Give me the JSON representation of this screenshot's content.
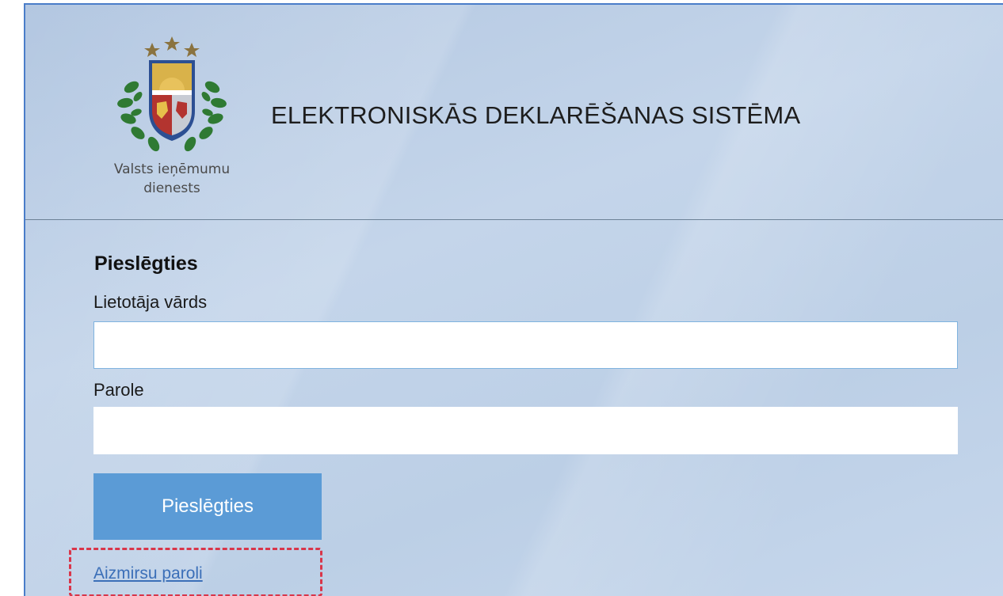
{
  "header": {
    "agency_line1": "Valsts ieņēmumu",
    "agency_line2": "dienests",
    "system_title": "ELEKTRONISKĀS DEKLARĒŠANAS SISTĒMA",
    "logo_icon": "latvia-coat-of-arms-icon"
  },
  "login": {
    "heading": "Pieslēgties",
    "username_label": "Lietotāja vārds",
    "username_value": "",
    "password_label": "Parole",
    "password_value": "",
    "submit_label": "Pieslēgties",
    "forgot_password_label": "Aizmirsu paroli"
  },
  "colors": {
    "background": "#c0d2e8",
    "button": "#5b9bd6",
    "link": "#3b6fb8",
    "highlight": "#d9364a"
  }
}
